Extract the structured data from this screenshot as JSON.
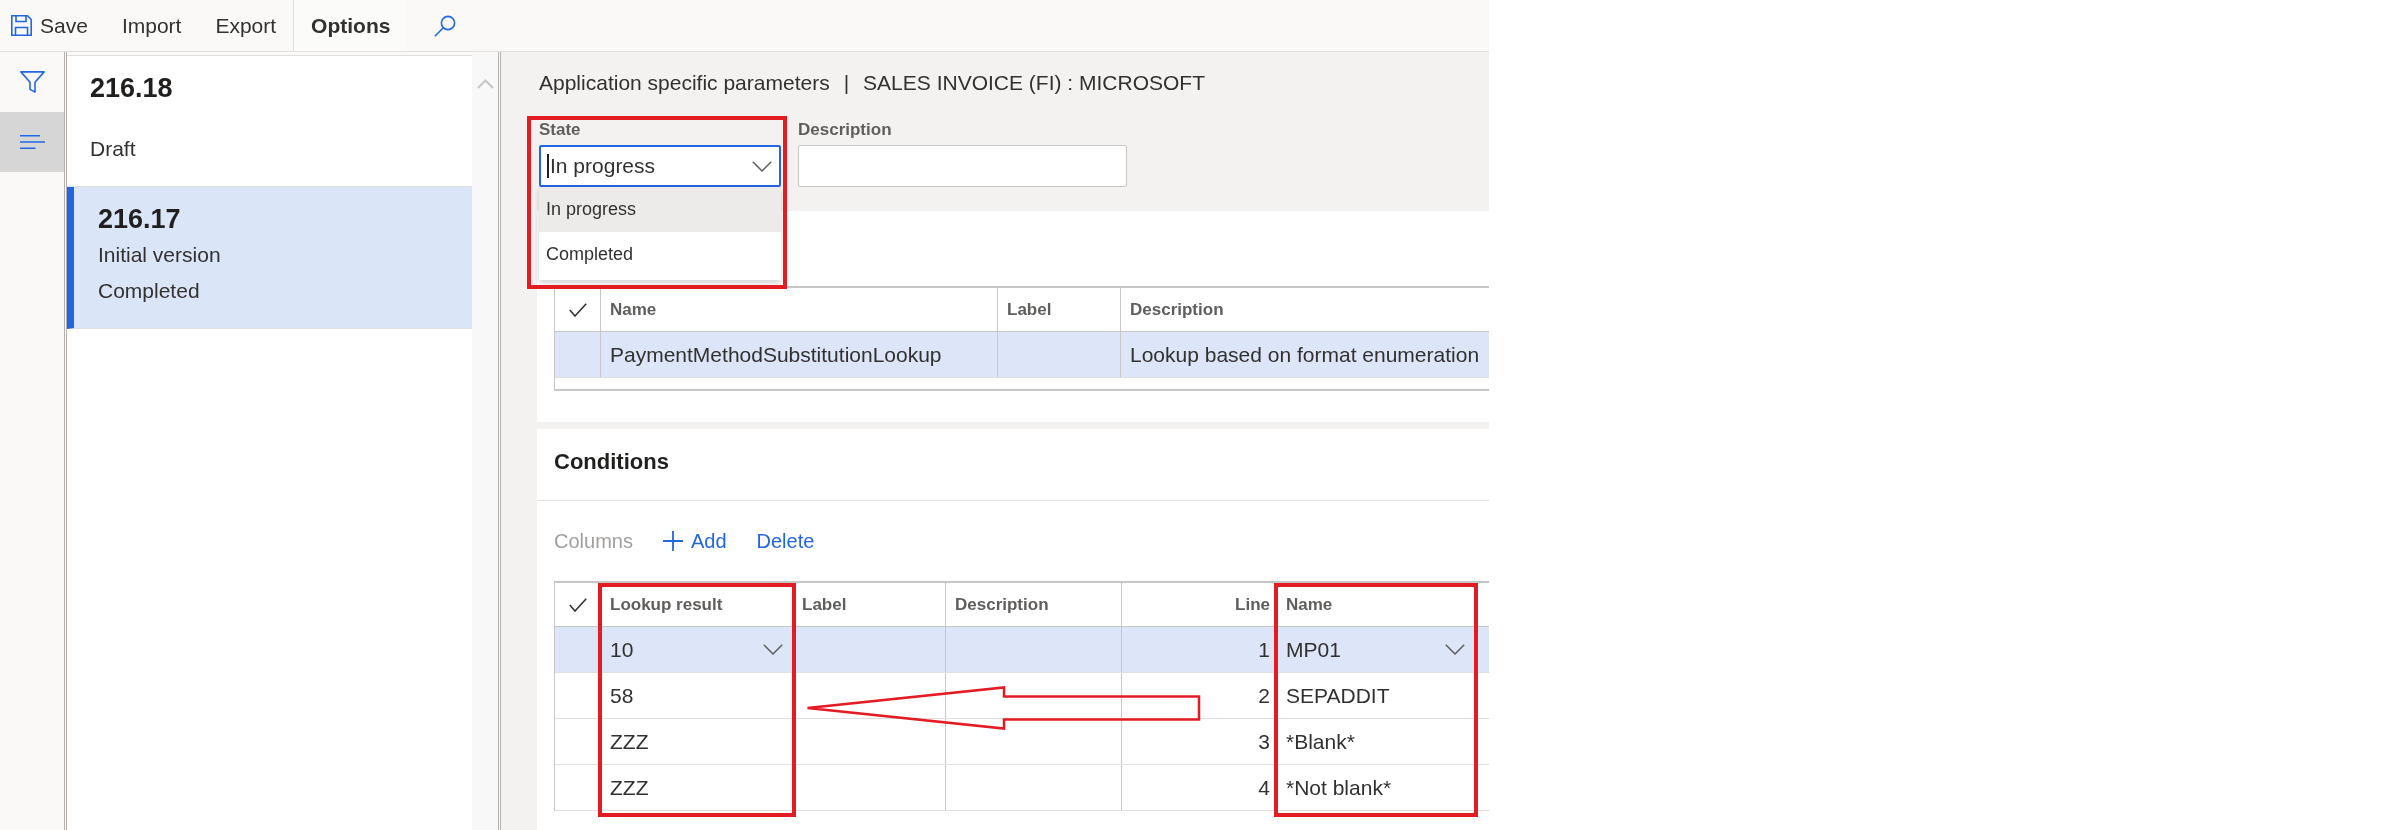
{
  "toolbar": {
    "buttons": [
      {
        "label": "Save",
        "kind": "icon-text"
      },
      {
        "label": "Import",
        "kind": "text"
      },
      {
        "label": "Export",
        "kind": "text"
      }
    ],
    "tabs": [
      {
        "label": "Options",
        "selected": true
      }
    ]
  },
  "nav_buttons": [
    {
      "selected": false
    },
    {
      "selected": true
    }
  ],
  "versions": [
    {
      "version": "216.18",
      "status": "Draft",
      "selected": false
    },
    {
      "version": "216.17",
      "description": "Initial version",
      "status": "Completed",
      "selected": true
    }
  ],
  "page_title": {
    "section": "Application specific parameters",
    "separator": "|",
    "context": "SALES INVOICE (FI) : MICROSOFT"
  },
  "state_field": {
    "label": "State",
    "value": "In progress",
    "focused": true,
    "expanded": true,
    "highlighted": true,
    "options": [
      {
        "label": "In progress",
        "selected": true
      },
      {
        "label": "Completed",
        "selected": false
      }
    ]
  },
  "description_field": {
    "label": "Description"
  },
  "lookups": {
    "columns": [
      "Name",
      "Label",
      "Description"
    ],
    "rows": [
      {
        "name": "PaymentMethodSubstitutionLookup",
        "description": "Lookup based on format enumeration",
        "selected": true
      }
    ]
  },
  "conditions": {
    "title": "Conditions",
    "actions": [
      {
        "label": "Columns",
        "kind": "text",
        "disabled": true
      },
      {
        "label": "Add",
        "kind": "icon-text",
        "disabled": false
      },
      {
        "label": "Delete",
        "kind": "text",
        "disabled": false
      }
    ],
    "columns": [
      {
        "label": "Lookup result",
        "highlighted": true
      },
      {
        "label": "Label",
        "highlighted": false
      },
      {
        "label": "Description",
        "highlighted": false
      },
      {
        "label": "Line",
        "highlighted": false
      },
      {
        "label": "Name",
        "highlighted": true
      }
    ],
    "rows": [
      {
        "lookup_result": "10",
        "line": "1",
        "name": "MP01",
        "selected": true
      },
      {
        "lookup_result": "58",
        "line": "2",
        "name": "SEPADDIT",
        "selected": false
      },
      {
        "lookup_result": "ZZZ",
        "line": "3",
        "name": "*Blank*",
        "selected": false
      },
      {
        "lookup_result": "ZZZ",
        "line": "4",
        "name": "*Not blank*",
        "selected": false
      }
    ],
    "pointer_arrow": true
  }
}
